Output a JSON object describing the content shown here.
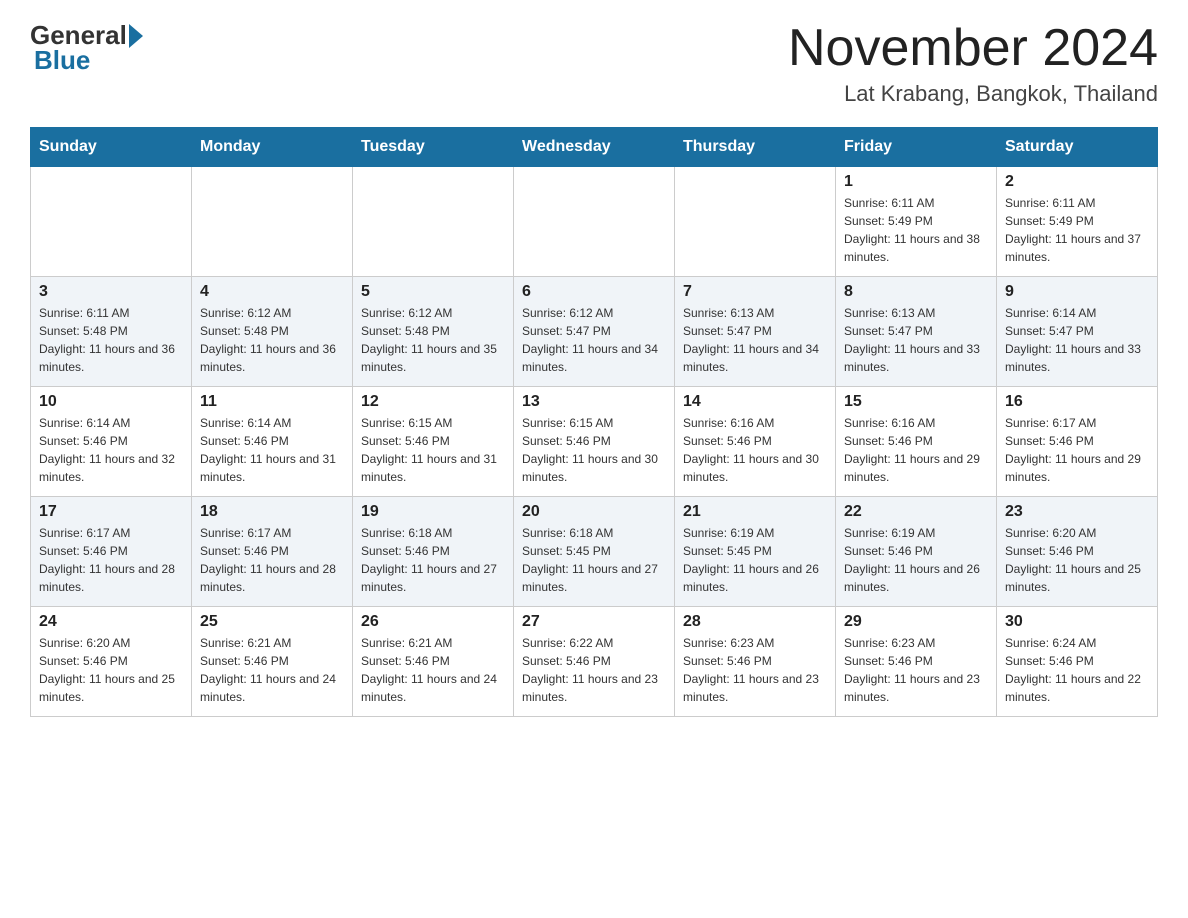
{
  "logo": {
    "general": "General",
    "blue": "Blue"
  },
  "title": "November 2024",
  "subtitle": "Lat Krabang, Bangkok, Thailand",
  "weekdays": [
    "Sunday",
    "Monday",
    "Tuesday",
    "Wednesday",
    "Thursday",
    "Friday",
    "Saturday"
  ],
  "weeks": [
    [
      {
        "day": "",
        "sunrise": "",
        "sunset": "",
        "daylight": ""
      },
      {
        "day": "",
        "sunrise": "",
        "sunset": "",
        "daylight": ""
      },
      {
        "day": "",
        "sunrise": "",
        "sunset": "",
        "daylight": ""
      },
      {
        "day": "",
        "sunrise": "",
        "sunset": "",
        "daylight": ""
      },
      {
        "day": "",
        "sunrise": "",
        "sunset": "",
        "daylight": ""
      },
      {
        "day": "1",
        "sunrise": "Sunrise: 6:11 AM",
        "sunset": "Sunset: 5:49 PM",
        "daylight": "Daylight: 11 hours and 38 minutes."
      },
      {
        "day": "2",
        "sunrise": "Sunrise: 6:11 AM",
        "sunset": "Sunset: 5:49 PM",
        "daylight": "Daylight: 11 hours and 37 minutes."
      }
    ],
    [
      {
        "day": "3",
        "sunrise": "Sunrise: 6:11 AM",
        "sunset": "Sunset: 5:48 PM",
        "daylight": "Daylight: 11 hours and 36 minutes."
      },
      {
        "day": "4",
        "sunrise": "Sunrise: 6:12 AM",
        "sunset": "Sunset: 5:48 PM",
        "daylight": "Daylight: 11 hours and 36 minutes."
      },
      {
        "day": "5",
        "sunrise": "Sunrise: 6:12 AM",
        "sunset": "Sunset: 5:48 PM",
        "daylight": "Daylight: 11 hours and 35 minutes."
      },
      {
        "day": "6",
        "sunrise": "Sunrise: 6:12 AM",
        "sunset": "Sunset: 5:47 PM",
        "daylight": "Daylight: 11 hours and 34 minutes."
      },
      {
        "day": "7",
        "sunrise": "Sunrise: 6:13 AM",
        "sunset": "Sunset: 5:47 PM",
        "daylight": "Daylight: 11 hours and 34 minutes."
      },
      {
        "day": "8",
        "sunrise": "Sunrise: 6:13 AM",
        "sunset": "Sunset: 5:47 PM",
        "daylight": "Daylight: 11 hours and 33 minutes."
      },
      {
        "day": "9",
        "sunrise": "Sunrise: 6:14 AM",
        "sunset": "Sunset: 5:47 PM",
        "daylight": "Daylight: 11 hours and 33 minutes."
      }
    ],
    [
      {
        "day": "10",
        "sunrise": "Sunrise: 6:14 AM",
        "sunset": "Sunset: 5:46 PM",
        "daylight": "Daylight: 11 hours and 32 minutes."
      },
      {
        "day": "11",
        "sunrise": "Sunrise: 6:14 AM",
        "sunset": "Sunset: 5:46 PM",
        "daylight": "Daylight: 11 hours and 31 minutes."
      },
      {
        "day": "12",
        "sunrise": "Sunrise: 6:15 AM",
        "sunset": "Sunset: 5:46 PM",
        "daylight": "Daylight: 11 hours and 31 minutes."
      },
      {
        "day": "13",
        "sunrise": "Sunrise: 6:15 AM",
        "sunset": "Sunset: 5:46 PM",
        "daylight": "Daylight: 11 hours and 30 minutes."
      },
      {
        "day": "14",
        "sunrise": "Sunrise: 6:16 AM",
        "sunset": "Sunset: 5:46 PM",
        "daylight": "Daylight: 11 hours and 30 minutes."
      },
      {
        "day": "15",
        "sunrise": "Sunrise: 6:16 AM",
        "sunset": "Sunset: 5:46 PM",
        "daylight": "Daylight: 11 hours and 29 minutes."
      },
      {
        "day": "16",
        "sunrise": "Sunrise: 6:17 AM",
        "sunset": "Sunset: 5:46 PM",
        "daylight": "Daylight: 11 hours and 29 minutes."
      }
    ],
    [
      {
        "day": "17",
        "sunrise": "Sunrise: 6:17 AM",
        "sunset": "Sunset: 5:46 PM",
        "daylight": "Daylight: 11 hours and 28 minutes."
      },
      {
        "day": "18",
        "sunrise": "Sunrise: 6:17 AM",
        "sunset": "Sunset: 5:46 PM",
        "daylight": "Daylight: 11 hours and 28 minutes."
      },
      {
        "day": "19",
        "sunrise": "Sunrise: 6:18 AM",
        "sunset": "Sunset: 5:46 PM",
        "daylight": "Daylight: 11 hours and 27 minutes."
      },
      {
        "day": "20",
        "sunrise": "Sunrise: 6:18 AM",
        "sunset": "Sunset: 5:45 PM",
        "daylight": "Daylight: 11 hours and 27 minutes."
      },
      {
        "day": "21",
        "sunrise": "Sunrise: 6:19 AM",
        "sunset": "Sunset: 5:45 PM",
        "daylight": "Daylight: 11 hours and 26 minutes."
      },
      {
        "day": "22",
        "sunrise": "Sunrise: 6:19 AM",
        "sunset": "Sunset: 5:46 PM",
        "daylight": "Daylight: 11 hours and 26 minutes."
      },
      {
        "day": "23",
        "sunrise": "Sunrise: 6:20 AM",
        "sunset": "Sunset: 5:46 PM",
        "daylight": "Daylight: 11 hours and 25 minutes."
      }
    ],
    [
      {
        "day": "24",
        "sunrise": "Sunrise: 6:20 AM",
        "sunset": "Sunset: 5:46 PM",
        "daylight": "Daylight: 11 hours and 25 minutes."
      },
      {
        "day": "25",
        "sunrise": "Sunrise: 6:21 AM",
        "sunset": "Sunset: 5:46 PM",
        "daylight": "Daylight: 11 hours and 24 minutes."
      },
      {
        "day": "26",
        "sunrise": "Sunrise: 6:21 AM",
        "sunset": "Sunset: 5:46 PM",
        "daylight": "Daylight: 11 hours and 24 minutes."
      },
      {
        "day": "27",
        "sunrise": "Sunrise: 6:22 AM",
        "sunset": "Sunset: 5:46 PM",
        "daylight": "Daylight: 11 hours and 23 minutes."
      },
      {
        "day": "28",
        "sunrise": "Sunrise: 6:23 AM",
        "sunset": "Sunset: 5:46 PM",
        "daylight": "Daylight: 11 hours and 23 minutes."
      },
      {
        "day": "29",
        "sunrise": "Sunrise: 6:23 AM",
        "sunset": "Sunset: 5:46 PM",
        "daylight": "Daylight: 11 hours and 23 minutes."
      },
      {
        "day": "30",
        "sunrise": "Sunrise: 6:24 AM",
        "sunset": "Sunset: 5:46 PM",
        "daylight": "Daylight: 11 hours and 22 minutes."
      }
    ]
  ]
}
